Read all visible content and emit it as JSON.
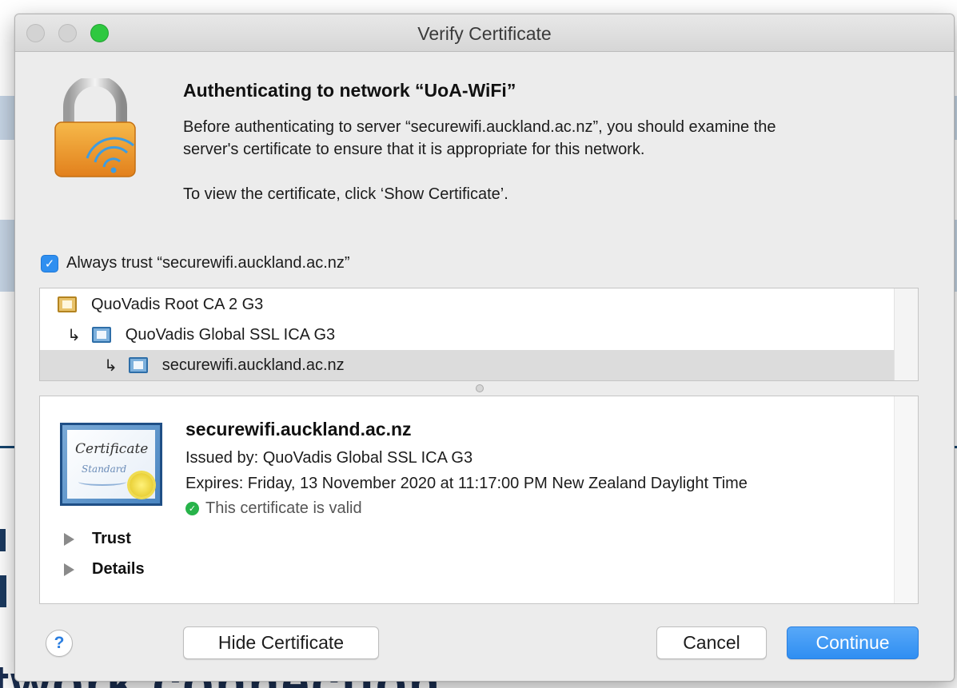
{
  "window": {
    "title": "Verify Certificate"
  },
  "prompt": {
    "heading": "Authenticating to network “UoA-WiFi”",
    "line1": "Before authenticating to server “securewifi.auckland.ac.nz”, you should examine the",
    "line2": "server's certificate to ensure that it is appropriate for this network.",
    "line3": "To view the certificate, click ‘Show Certificate’."
  },
  "always_trust": {
    "checked": true,
    "label": "Always trust “securewifi.auckland.ac.nz”"
  },
  "tree": {
    "items": [
      {
        "label": "QuoVadis Root CA 2 G3",
        "level": 0,
        "icon": "root-certificate-icon"
      },
      {
        "label": "QuoVadis Global SSL ICA G3",
        "level": 1,
        "icon": "intermediate-certificate-icon"
      },
      {
        "label": "securewifi.auckland.ac.nz",
        "level": 2,
        "icon": "leaf-certificate-icon",
        "selected": true
      }
    ]
  },
  "detail": {
    "badge_text1": "Certificate",
    "badge_text2": "Standard",
    "name": "securewifi.auckland.ac.nz",
    "issued_by": "Issued by: QuoVadis Global SSL ICA G3",
    "expires": "Expires: Friday, 13 November 2020 at 11:17:00 PM New Zealand Daylight Time",
    "status": "This certificate is valid",
    "sections": [
      "Trust",
      "Details"
    ]
  },
  "buttons": {
    "help": "?",
    "hide": "Hide Certificate",
    "cancel": "Cancel",
    "continue": "Continue"
  },
  "background": {
    "text": "twork connection"
  },
  "colors": {
    "accent": "#2f8ff0",
    "valid": "#27b34a"
  }
}
